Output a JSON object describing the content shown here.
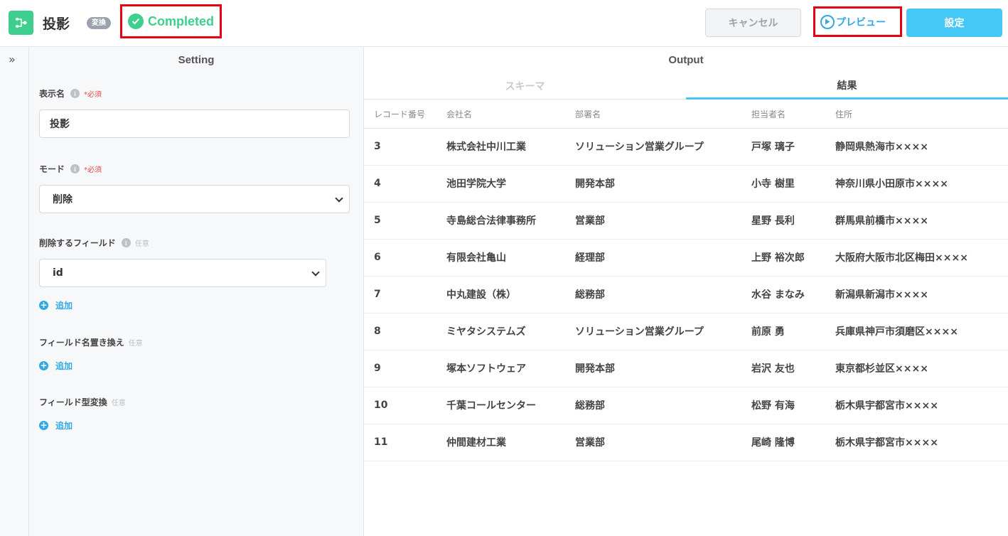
{
  "header": {
    "title": "投影",
    "tag": "変換",
    "status": "Completed",
    "cancel_label": "キャンセル",
    "preview_label": "プレビュー",
    "settings_label": "設定"
  },
  "setting": {
    "panel_title": "Setting",
    "display_name": {
      "label": "表示名",
      "required": "*必須",
      "value": "投影"
    },
    "mode": {
      "label": "モード",
      "required": "*必須",
      "value": "削除"
    },
    "delete_fields": {
      "label": "削除するフィールド",
      "optional": "任意",
      "value": "id",
      "add_label": "追加"
    },
    "rename_fields": {
      "label": "フィールド名置き換え",
      "optional": "任意",
      "add_label": "追加"
    },
    "convert_fields": {
      "label": "フィールド型変換",
      "optional": "任意",
      "add_label": "追加"
    }
  },
  "output": {
    "panel_title": "Output",
    "tabs": [
      "スキーマ",
      "結果"
    ],
    "columns": [
      "レコード番号",
      "会社名",
      "部署名",
      "担当者名",
      "住所"
    ],
    "rows": [
      [
        "3",
        "株式会社中川工業",
        "ソリューション営業グループ",
        "戸塚 璃子",
        "静岡県熱海市××××"
      ],
      [
        "4",
        "池田学院大学",
        "開発本部",
        "小寺 樹里",
        "神奈川県小田原市××××"
      ],
      [
        "5",
        "寺島総合法律事務所",
        "営業部",
        "星野 長利",
        "群馬県前橋市××××"
      ],
      [
        "6",
        "有限会社亀山",
        "経理部",
        "上野 裕次郎",
        "大阪府大阪市北区梅田××××"
      ],
      [
        "7",
        "中丸建設（株）",
        "総務部",
        "水谷 まなみ",
        "新潟県新潟市××××"
      ],
      [
        "8",
        "ミヤタシステムズ",
        "ソリューション営業グループ",
        "前原 勇",
        "兵庫県神戸市須磨区××××"
      ],
      [
        "9",
        "塚本ソフトウェア",
        "開発本部",
        "岩沢 友也",
        "東京都杉並区××××"
      ],
      [
        "10",
        "千葉コールセンター",
        "総務部",
        "松野 有海",
        "栃木県宇都宮市××××"
      ],
      [
        "11",
        "仲間建材工業",
        "営業部",
        "尾崎 隆博",
        "栃木県宇都宮市××××"
      ]
    ]
  }
}
